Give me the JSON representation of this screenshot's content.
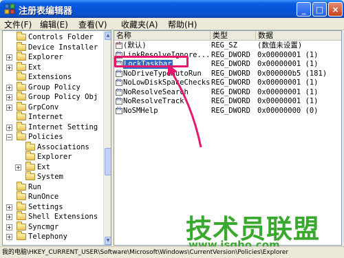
{
  "window": {
    "title": "注册表编辑器",
    "minimize_label": "_",
    "maximize_label": "□",
    "close_label": "×"
  },
  "menu": [
    "文件(F)",
    "编辑(E)",
    "查看(V)",
    "收藏夹(A)",
    "帮助(H)"
  ],
  "tree": {
    "items": [
      {
        "label": "Controls Folder",
        "level": 0,
        "expander": ""
      },
      {
        "label": "Device Installer",
        "level": 0,
        "expander": ""
      },
      {
        "label": "Explorer",
        "level": 0,
        "expander": "+"
      },
      {
        "label": "Ext",
        "level": 0,
        "expander": "+"
      },
      {
        "label": "Extensions",
        "level": 0,
        "expander": ""
      },
      {
        "label": "Group Policy",
        "level": 0,
        "expander": "+"
      },
      {
        "label": "Group Policy Obj",
        "level": 0,
        "expander": "+"
      },
      {
        "label": "GrpConv",
        "level": 0,
        "expander": "+"
      },
      {
        "label": "Internet",
        "level": 0,
        "expander": ""
      },
      {
        "label": "Internet Setting",
        "level": 0,
        "expander": "+"
      },
      {
        "label": "Policies",
        "level": 0,
        "expander": "−"
      },
      {
        "label": "Associations",
        "level": 1,
        "expander": ""
      },
      {
        "label": "Explorer",
        "level": 1,
        "expander": ""
      },
      {
        "label": "Ext",
        "level": 1,
        "expander": "+"
      },
      {
        "label": "System",
        "level": 1,
        "expander": ""
      },
      {
        "label": "Run",
        "level": 0,
        "expander": ""
      },
      {
        "label": "RunOnce",
        "level": 0,
        "expander": ""
      },
      {
        "label": "Settings",
        "level": 0,
        "expander": "+"
      },
      {
        "label": "Shell Extensions",
        "level": 0,
        "expander": "+"
      },
      {
        "label": "Syncmgr",
        "level": 0,
        "expander": "+"
      },
      {
        "label": "Telephony",
        "level": 0,
        "expander": "+"
      }
    ]
  },
  "list": {
    "headers": [
      "名称",
      "类型",
      "数据"
    ],
    "rows": [
      {
        "name": "(默认)",
        "type": "REG_SZ",
        "data": "(数值未设置)",
        "icon": "sz"
      },
      {
        "name": "LinkResolveIgnore...",
        "type": "REG_DWORD",
        "data": "0x00000001 (1)",
        "icon": "dw"
      },
      {
        "name": "LockTaskbar",
        "type": "REG_DWORD",
        "data": "0x00000001 (1)",
        "icon": "dw",
        "selected": true
      },
      {
        "name": "NoDriveTypeAutoRun",
        "type": "REG_DWORD",
        "data": "0x000000b5 (181)",
        "icon": "dw"
      },
      {
        "name": "NoLowDiskSpaceChecks",
        "type": "REG_DWORD",
        "data": "0x00000001 (1)",
        "icon": "dw"
      },
      {
        "name": "NoResolveSearch",
        "type": "REG_DWORD",
        "data": "0x00000001 (1)",
        "icon": "dw"
      },
      {
        "name": "NoResolveTrack",
        "type": "REG_DWORD",
        "data": "0x00000001 (1)",
        "icon": "dw"
      },
      {
        "name": "NoSMHelp",
        "type": "REG_DWORD",
        "data": "0x00000000 (0)",
        "icon": "dw"
      }
    ]
  },
  "status": "我的电脑\\HKEY_CURRENT_USER\\Software\\Microsoft\\Windows\\CurrentVersion\\Policies\\Explorer",
  "watermark": {
    "brand": "技术员联盟",
    "url": "www.jsgho.com"
  },
  "colors": {
    "title_blue": "#0554d8",
    "selection_blue": "#316ac5",
    "highlight_pink": "#e8176e",
    "watermark_green": "#39a92e"
  }
}
